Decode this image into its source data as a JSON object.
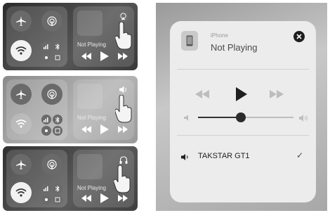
{
  "panels": [
    {
      "now_playing": "Not Playing",
      "airplay_icon": "airplay-icon"
    },
    {
      "now_playing": "Not Playing",
      "airplay_icon": "speaker-icon"
    },
    {
      "now_playing": "Not Playing",
      "airplay_icon": "headphones-icon"
    }
  ],
  "detail": {
    "source_label": "iPhone",
    "title": "Not Playing",
    "volume_level": 0.45,
    "device_name": "TAKSTAR GT1",
    "check_mark": "✓"
  },
  "colors": {
    "accent": "#1e1e1e",
    "panel_dark": "#3a3a3a",
    "panel_light": "#a8a8a8"
  }
}
